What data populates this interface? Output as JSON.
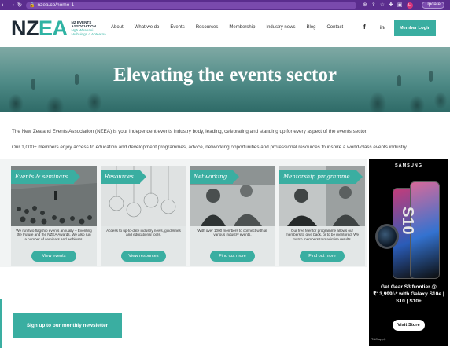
{
  "browser": {
    "back_icon": "arrow-left-icon",
    "forward_icon": "arrow-right-icon",
    "reload_icon": "reload-icon",
    "lock_icon": "lock-icon",
    "url": "nzea.co/home-1",
    "update_label": "Update",
    "profile_initial": "L"
  },
  "site": {
    "logo_main": "NZ",
    "logo_accent": "EA",
    "logo_lines": [
      "NZ EVENTS",
      "ASSOCIATION",
      "Ngā Whanaui",
      "Huihuinga o Aotearoa"
    ],
    "nav": [
      "About",
      "What we do",
      "Events",
      "Resources",
      "Membership",
      "Industry news",
      "Blog",
      "Contact"
    ],
    "social": {
      "facebook": "f",
      "linkedin": "in"
    },
    "member_login": "Member Login",
    "accent_color": "#3aaea1"
  },
  "hero": {
    "title": "Elevating the events sector"
  },
  "intro": {
    "p1": "The New Zealand Events Association (NZEA) is your independent events industry body, leading, celebrating and standing up for every aspect of the events sector.",
    "p2": "Our 1,000+ members enjoy access to education and development programmes, advice, networking opportunities and professional resources to inspire a world-class events industry."
  },
  "cards": [
    {
      "tag": "Events & seminars",
      "desc": "We run two flagship events annually – Eventing the Future and the NZEA Awards. We also run a number of seminars and webinars.",
      "cta": "View events"
    },
    {
      "tag": "Resources",
      "desc": "Access to up-to-date industry news, guidelines and educational tools.",
      "cta": "View resources"
    },
    {
      "tag": "Networking",
      "desc": "With over 1000 members to connect with at various industry events.",
      "cta": "Find out more"
    },
    {
      "tag": "Mentorship programme",
      "desc": "Our free Mentor programme allows our members to give back, or to be mentored. We match members to maximise results.",
      "cta": "Find out more"
    }
  ],
  "ad": {
    "brand": "SAMSUNG",
    "model": "S10",
    "headline": "Get Gear S3 frontier @ ₹13,999/-* with Galaxy S10e | S10 | S10+",
    "cta": "Visit Store",
    "info": "T&C apply"
  },
  "newsletter": {
    "label": "Sign up to our monthly newsletter"
  }
}
